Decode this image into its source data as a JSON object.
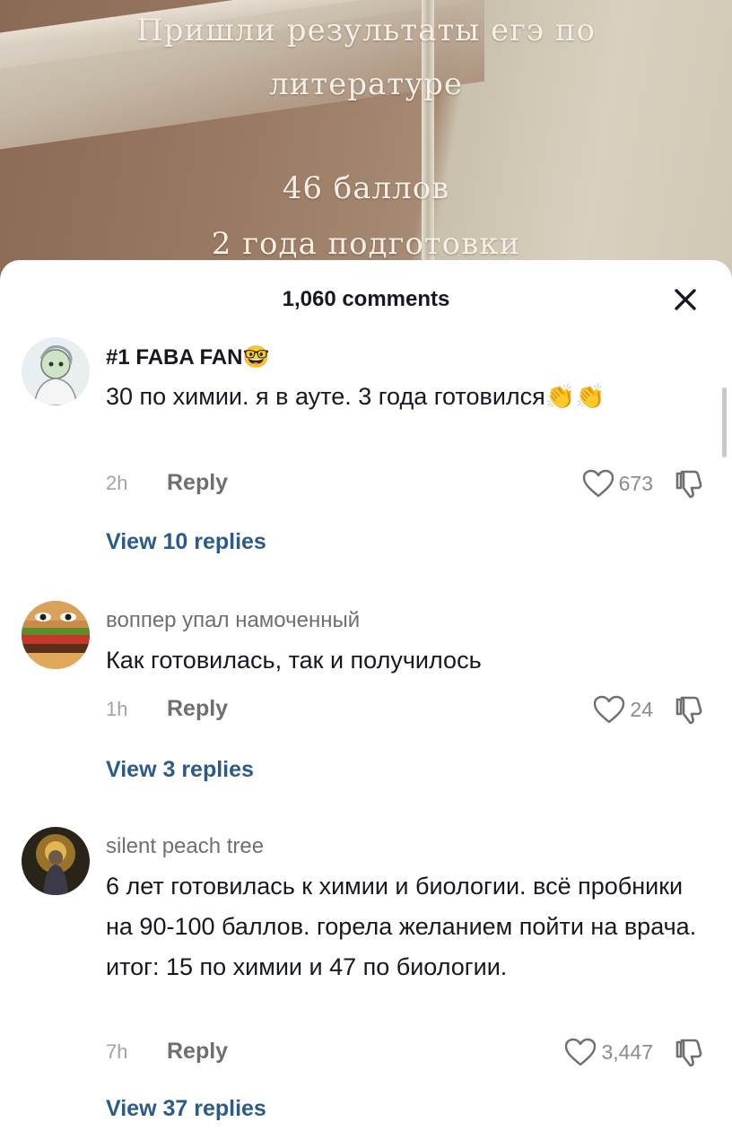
{
  "video": {
    "overlay_lines": [
      "Пришли результаты егэ по",
      "литературе",
      "46 баллов",
      "2 года подготовки"
    ]
  },
  "comments_panel": {
    "title": "1,060 comments",
    "close_icon": "close-icon"
  },
  "comments": [
    {
      "username": "#1 FABA FAN🤓",
      "text": "30 по химии. я в ауте. 3 года готовился👏👏",
      "time": "2h",
      "reply_label": "Reply",
      "likes": "673",
      "view_replies": "View 10 replies"
    },
    {
      "username": "воппер упал намоченный",
      "text": "Как готовилась, так и получилось",
      "time": "1h",
      "reply_label": "Reply",
      "likes": "24",
      "view_replies": "View 3 replies"
    },
    {
      "username": "silent peach tree",
      "text": "6 лет готовилась к химии и биологии. всё пробники на 90-100 баллов. горела желанием пойти на врача. итог: 15 по химии и 47 по биологии.",
      "time": "7h",
      "reply_label": "Reply",
      "likes": "3,447",
      "view_replies": "View 37 replies"
    }
  ],
  "colors": {
    "link": "#2b5a8c",
    "text_primary": "#161823",
    "text_secondary": "#6e6f75"
  }
}
